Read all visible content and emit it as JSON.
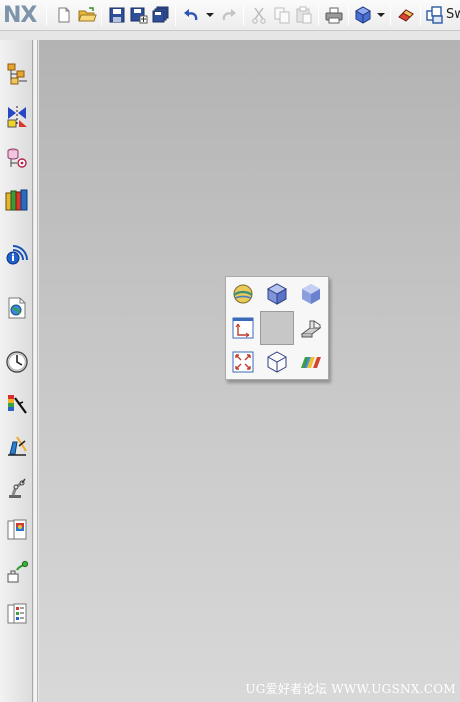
{
  "app": {
    "logo": "NX",
    "start_label": "Sw"
  },
  "toolbar": {
    "buttons": [
      {
        "icon": "new-file-icon"
      },
      {
        "icon": "open-folder-icon"
      },
      {
        "icon": "save-icon"
      },
      {
        "icon": "save-as-icon"
      },
      {
        "icon": "save-all-icon"
      },
      {
        "icon": "undo-icon"
      },
      {
        "icon": "undo-list-caret-icon"
      },
      {
        "icon": "redo-icon"
      },
      {
        "icon": "cut-icon"
      },
      {
        "icon": "copy-icon"
      },
      {
        "icon": "paste-icon"
      },
      {
        "icon": "print-icon"
      },
      {
        "icon": "render-style-cube-icon"
      },
      {
        "icon": "render-style-caret-icon"
      },
      {
        "icon": "selection-eraser-icon"
      },
      {
        "icon": "start-menu-icon"
      }
    ]
  },
  "resource_bar": {
    "items": [
      {
        "icon": "assembly-navigator-icon"
      },
      {
        "icon": "constraint-navigator-icon"
      },
      {
        "icon": "part-navigator-icon"
      },
      {
        "icon": "reuse-library-icon"
      },
      {
        "icon": "hd3d-tools-icon"
      },
      {
        "icon": "web-browser-icon"
      },
      {
        "icon": "history-icon"
      },
      {
        "icon": "process-studio-icon"
      },
      {
        "icon": "manufacturing-wizard-icon"
      },
      {
        "icon": "robotics-icon"
      },
      {
        "icon": "system-materials-icon"
      },
      {
        "icon": "roles-icon"
      },
      {
        "icon": "palette-list-icon"
      }
    ]
  },
  "radial_menu": {
    "items": [
      {
        "icon": "face-analysis-icon"
      },
      {
        "icon": "shaded-with-edges-icon"
      },
      {
        "icon": "shaded-icon"
      },
      {
        "icon": "wcs-icon"
      },
      {
        "icon": "sketch-section-icon"
      },
      {
        "icon": "fit-view-icon"
      },
      {
        "icon": "wireframe-cube-icon"
      },
      {
        "icon": "studio-color-icon"
      }
    ]
  },
  "watermark": "UG爱好者论坛 WWW.UGSNX.COM",
  "colors": {
    "logo": "#7d94ab",
    "graphics_top": "#b3b3b3",
    "graphics_bottom": "#d8d8d8",
    "toolbar": "#f2f2f2"
  }
}
